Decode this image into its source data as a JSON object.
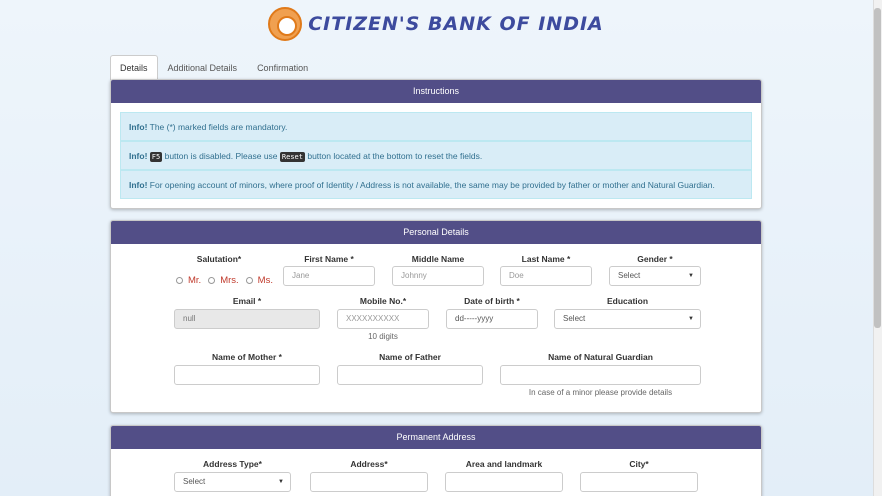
{
  "header": {
    "brand": "CITIZEN'S BANK OF INDIA",
    "logo_icon": "bank-seal"
  },
  "tabs": [
    {
      "label": "Details",
      "active": true
    },
    {
      "label": "Additional Details",
      "active": false
    },
    {
      "label": "Confirmation",
      "active": false
    }
  ],
  "instructions": {
    "title": "Instructions",
    "info1": {
      "prefix": "Info!",
      "text": " The (*) marked fields are mandatory."
    },
    "info2": {
      "prefix": "Info!",
      "key1": "F5",
      "text1": " button is disabled. Please use ",
      "key2": "Reset",
      "text2": " button located at the bottom to reset the fields."
    },
    "info3": {
      "prefix": "Info!",
      "text": " For opening account of minors, where proof of Identity / Address is not available, the same may be provided by father or mother and Natural Guardian."
    }
  },
  "personal": {
    "title": "Personal Details",
    "salutation_label": "Salutation*",
    "salutations": [
      "Mr.",
      "Mrs.",
      "Ms."
    ],
    "first_name_label": "First Name *",
    "first_name_placeholder": "Jane",
    "middle_name_label": "Middle Name",
    "middle_name_placeholder": "Johnny",
    "last_name_label": "Last Name *",
    "last_name_placeholder": "Doe",
    "gender_label": "Gender *",
    "gender_value": "Select",
    "email_label": "Email *",
    "email_value": "null",
    "mobile_label": "Mobile No.*",
    "mobile_placeholder": "XXXXXXXXXX",
    "mobile_help": "10 digits",
    "dob_label": "Date of birth *",
    "dob_placeholder": "dd-----yyyy",
    "education_label": "Education",
    "education_value": "Select",
    "mother_label": "Name of Mother *",
    "father_label": "Name of Father",
    "guardian_label": "Name of Natural Guardian",
    "guardian_help": "In case of a minor please provide details"
  },
  "address": {
    "title": "Permanent Address",
    "type_label": "Address Type*",
    "type_value": "Select",
    "address_label": "Address*",
    "area_label": "Area and landmark",
    "city_label": "City*"
  },
  "colors": {
    "panel_header": "#524e87",
    "info_bg": "#d9edf7",
    "brand": "#3d4b9e",
    "logo": "#e07a1a"
  }
}
